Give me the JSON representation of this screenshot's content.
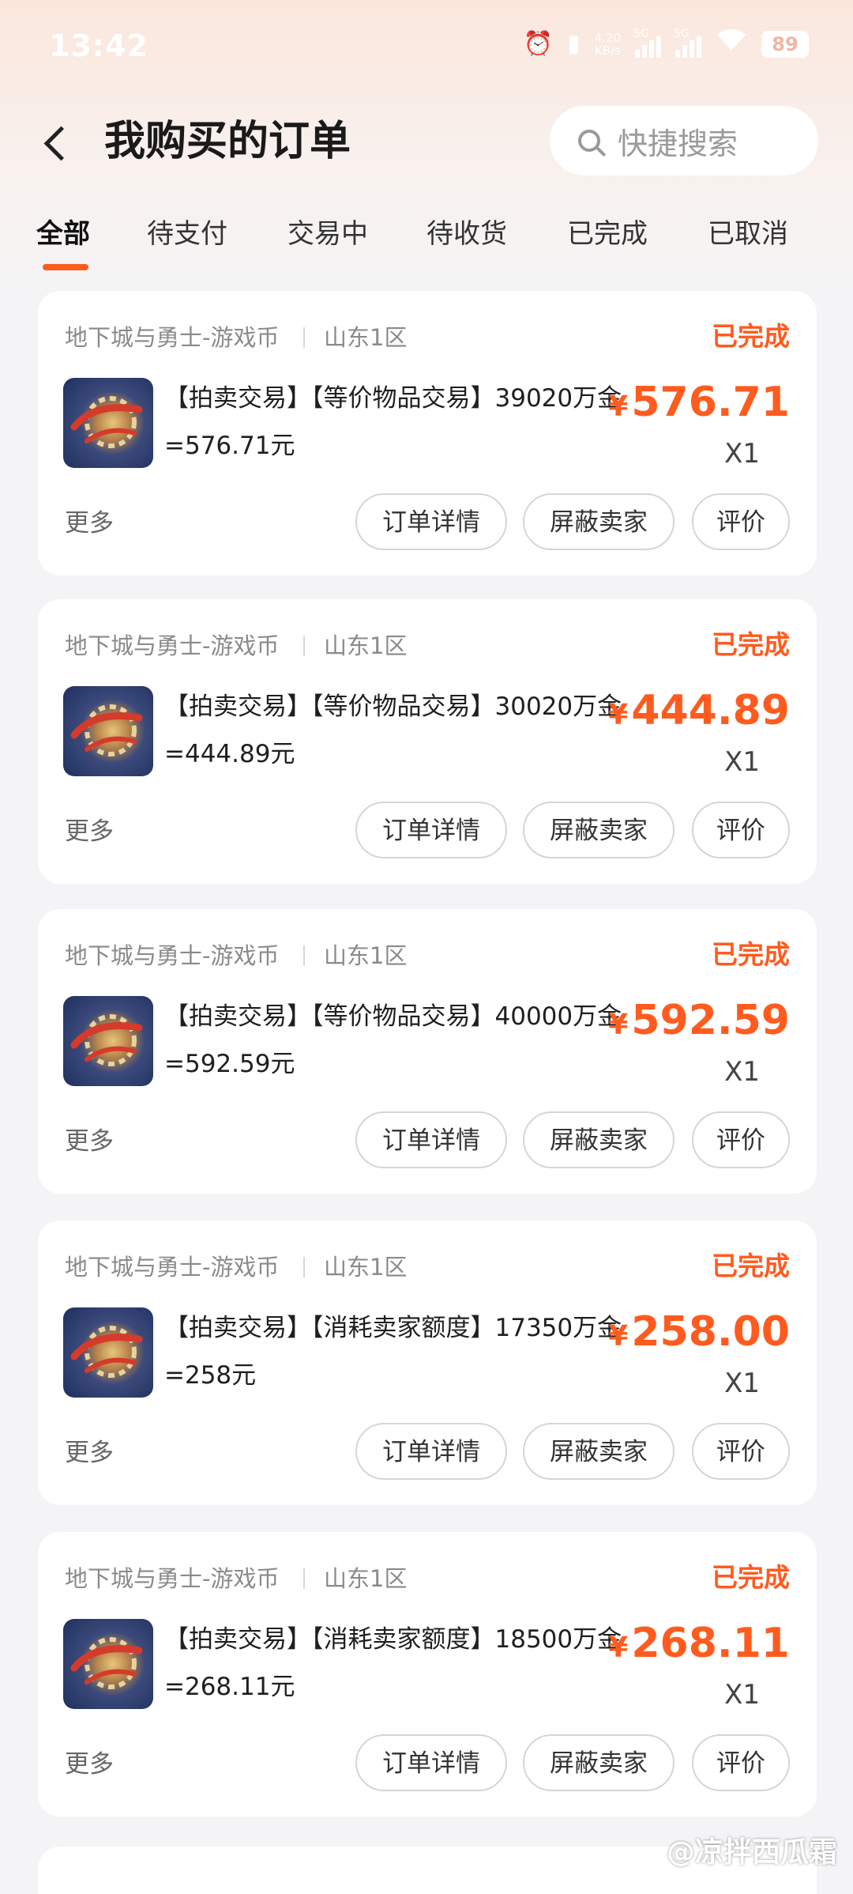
{
  "status_bar": {
    "time": "13:42",
    "net_speed_value": "4.20",
    "net_speed_unit": "KB/s",
    "sim1_label": "5G",
    "sim2_label": "5G",
    "battery": "89",
    "icons": [
      "alarm-icon",
      "vibrate-icon",
      "signal-icon",
      "wifi-icon",
      "battery-icon"
    ]
  },
  "header": {
    "title": "我购买的订单",
    "search_placeholder": "快捷搜索"
  },
  "tabs": [
    {
      "label": "全部",
      "active": true
    },
    {
      "label": "待支付",
      "active": false
    },
    {
      "label": "交易中",
      "active": false
    },
    {
      "label": "待收货",
      "active": false
    },
    {
      "label": "已完成",
      "active": false
    },
    {
      "label": "已取消",
      "active": false
    }
  ],
  "accent_color": "#ff5b1f",
  "orders": [
    {
      "game": "地下城与勇士-游戏币",
      "server": "山东1区",
      "status": "已完成",
      "desc_line1": "【拍卖交易】【等价物品交易】39020万金",
      "desc_line2": "=576.71元",
      "currency": "¥",
      "price": "576.71",
      "qty": "X1",
      "more": "更多",
      "btn_detail": "订单详情",
      "btn_block": "屏蔽卖家",
      "btn_rate": "评价"
    },
    {
      "game": "地下城与勇士-游戏币",
      "server": "山东1区",
      "status": "已完成",
      "desc_line1": "【拍卖交易】【等价物品交易】30020万金",
      "desc_line2": "=444.89元",
      "currency": "¥",
      "price": "444.89",
      "qty": "X1",
      "more": "更多",
      "btn_detail": "订单详情",
      "btn_block": "屏蔽卖家",
      "btn_rate": "评价"
    },
    {
      "game": "地下城与勇士-游戏币",
      "server": "山东1区",
      "status": "已完成",
      "desc_line1": "【拍卖交易】【等价物品交易】40000万金",
      "desc_line2": "=592.59元",
      "currency": "¥",
      "price": "592.59",
      "qty": "X1",
      "more": "更多",
      "btn_detail": "订单详情",
      "btn_block": "屏蔽卖家",
      "btn_rate": "评价"
    },
    {
      "game": "地下城与勇士-游戏币",
      "server": "山东1区",
      "status": "已完成",
      "desc_line1": "【拍卖交易】【消耗卖家额度】17350万金",
      "desc_line2": "=258元",
      "currency": "¥",
      "price": "258.00",
      "qty": "X1",
      "more": "更多",
      "btn_detail": "订单详情",
      "btn_block": "屏蔽卖家",
      "btn_rate": "评价"
    },
    {
      "game": "地下城与勇士-游戏币",
      "server": "山东1区",
      "status": "已完成",
      "desc_line1": "【拍卖交易】【消耗卖家额度】18500万金",
      "desc_line2": "=268.11元",
      "currency": "¥",
      "price": "268.11",
      "qty": "X1",
      "more": "更多",
      "btn_detail": "订单详情",
      "btn_block": "屏蔽卖家",
      "btn_rate": "评价"
    }
  ],
  "watermark": "@凉拌西瓜霜"
}
